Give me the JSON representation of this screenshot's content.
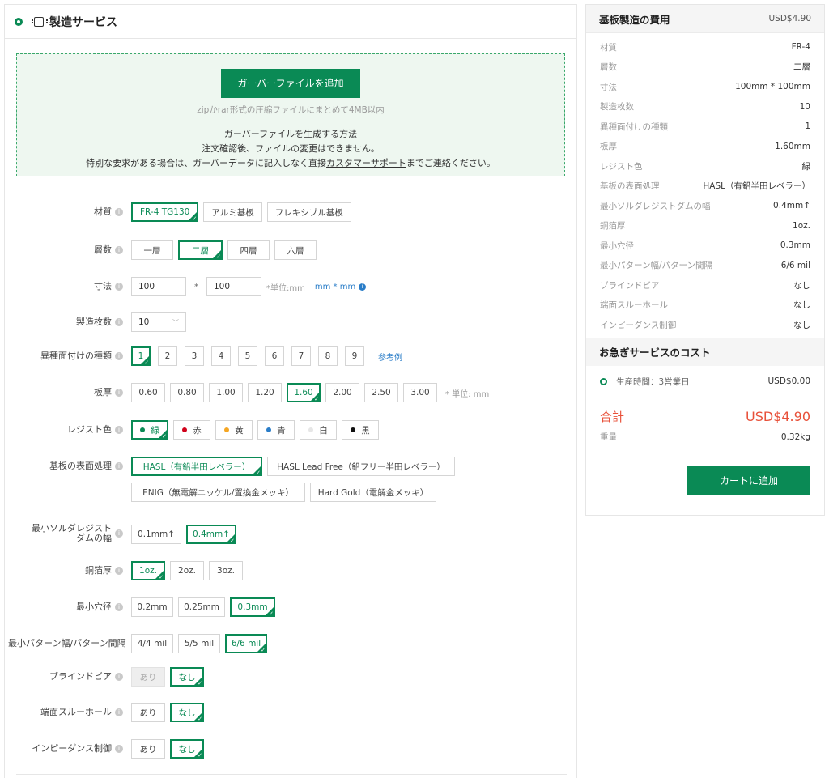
{
  "header": {
    "title": "製造サービス"
  },
  "upload": {
    "button_label": "ガーバーファイルを追加",
    "note": "zipかrar形式の圧縮ファイルにまとめて4MB以内",
    "howto_link": "ガーバーファイルを生成する方法",
    "line1": "注文確認後、ファイルの変更はできません。",
    "line2_pre": "特別な要求がある場合は、ガーバーデータに記入しなく直接",
    "line2_link": "カスタマーサポート",
    "line2_post": "までご連絡ください。"
  },
  "form": {
    "material": {
      "label": "材質",
      "options": [
        "FR-4 TG130",
        "アルミ基板",
        "フレキシブル基板"
      ],
      "selected_index": 0
    },
    "layers": {
      "label": "層数",
      "options": [
        "一層",
        "二層",
        "四層",
        "六層"
      ],
      "selected_index": 1
    },
    "size": {
      "label": "寸法",
      "width": "100",
      "times": "*",
      "height": "100",
      "unit_note": "*単位:mm",
      "unit_link": "mm * mm"
    },
    "quantity": {
      "label": "製造枚数",
      "value": "10"
    },
    "panel_types": {
      "label": "異種面付けの種類",
      "options": [
        "1",
        "2",
        "3",
        "4",
        "5",
        "6",
        "7",
        "8",
        "9"
      ],
      "selected_index": 0,
      "ref_link": "参考例"
    },
    "thickness": {
      "label": "板厚",
      "options": [
        "0.60",
        "0.80",
        "1.00",
        "1.20",
        "1.60",
        "2.00",
        "2.50",
        "3.00"
      ],
      "selected_index": 4,
      "unit_note": "* 単位: mm"
    },
    "resist_color": {
      "label": "レジスト色",
      "options": [
        {
          "label": "緑",
          "color": "#0a8a55"
        },
        {
          "label": "赤",
          "color": "#d0021b"
        },
        {
          "label": "黄",
          "color": "#f5a623"
        },
        {
          "label": "青",
          "color": "#2a7dc8"
        },
        {
          "label": "白",
          "color": "#e6e6e6"
        },
        {
          "label": "黒",
          "color": "#111111"
        }
      ],
      "selected_index": 0
    },
    "surface": {
      "label": "基板の表面処理",
      "options": [
        "HASL（有鉛半田レベラー）",
        "HASL Lead Free（鉛フリー半田レベラー）",
        "ENIG（無電解ニッケル/置換金メッキ）",
        "Hard Gold（電解金メッキ）"
      ],
      "selected_index": 0
    },
    "solder_dam": {
      "label_line1": "最小ソルダレジスト",
      "label_line2": "ダムの幅",
      "options": [
        "0.1mm↑",
        "0.4mm↑"
      ],
      "selected_index": 1
    },
    "copper": {
      "label": "銅箔厚",
      "options": [
        "1oz.",
        "2oz.",
        "3oz."
      ],
      "selected_index": 0
    },
    "min_hole": {
      "label": "最小穴径",
      "options": [
        "0.2mm",
        "0.25mm",
        "0.3mm"
      ],
      "selected_index": 2
    },
    "min_trace": {
      "label": "最小パターン幅/パターン間隔",
      "options": [
        "4/4 mil",
        "5/5 mil",
        "6/6 mil"
      ],
      "selected_index": 2
    },
    "blind_via": {
      "label": "ブラインドビア",
      "options": [
        "あり",
        "なし"
      ],
      "selected_index": 1,
      "disabled_index": 0
    },
    "edge_plating": {
      "label": "端面スルーホール",
      "options": [
        "あり",
        "なし"
      ],
      "selected_index": 1
    },
    "impedance": {
      "label": "インピーダンス制御",
      "options": [
        "あり",
        "なし"
      ],
      "selected_index": 1
    }
  },
  "cost_panel": {
    "title": "基板製造の費用",
    "price": "USD$4.90",
    "specs": [
      {
        "key": "材質",
        "value": "FR-4"
      },
      {
        "key": "層数",
        "value": "二層"
      },
      {
        "key": "寸法",
        "value": "100mm * 100mm"
      },
      {
        "key": "製造枚数",
        "value": "10"
      },
      {
        "key": "異種面付けの種類",
        "value": "1"
      },
      {
        "key": "板厚",
        "value": "1.60mm"
      },
      {
        "key": "レジスト色",
        "value": "緑"
      },
      {
        "key": "基板の表面処理",
        "value": "HASL（有鉛半田レベラー）"
      },
      {
        "key": "最小ソルダレジストダムの幅",
        "value": "0.4mm↑"
      },
      {
        "key": "銅箔厚",
        "value": "1oz."
      },
      {
        "key": "最小穴径",
        "value": "0.3mm"
      },
      {
        "key": "最小パターン幅/パターン間隔",
        "value": "6/6 mil"
      },
      {
        "key": "ブラインドビア",
        "value": "なし"
      },
      {
        "key": "端面スルーホール",
        "value": "なし"
      },
      {
        "key": "インピーダンス制御",
        "value": "なし"
      }
    ],
    "rush_title": "お急ぎサービスのコスト",
    "rush_option": "生産時間：3営業日",
    "rush_price": "USD$0.00",
    "total_label": "合計",
    "total_value": "USD$4.90",
    "weight_label": "重量",
    "weight_value": "0.32kg",
    "cart_button": "カートに追加"
  },
  "colors": {
    "accent": "#0a8a55",
    "total": "#e8513a",
    "link": "#2a7dc8"
  }
}
